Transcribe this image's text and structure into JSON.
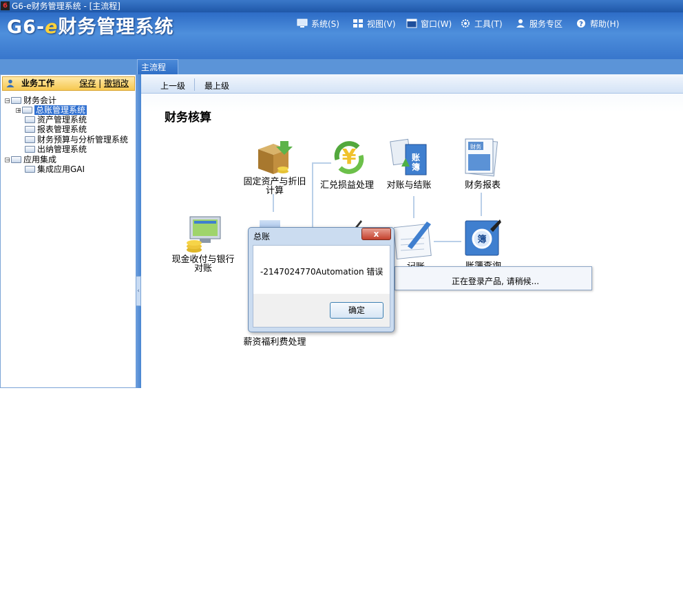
{
  "window": {
    "title": "G6-e财务管理系统 - [主流程]"
  },
  "header": {
    "logo_prefix": "G6-",
    "logo_e": "e",
    "logo_suffix": "财务管理系统",
    "menu": [
      {
        "label": "系统(S)",
        "icon": "monitor-icon"
      },
      {
        "label": "视图(V)",
        "icon": "grid-icon"
      },
      {
        "label": "窗口(W)",
        "icon": "window-icon"
      },
      {
        "label": "工具(T)",
        "icon": "gear-icon"
      },
      {
        "label": "服务专区",
        "icon": "person-icon"
      },
      {
        "label": "帮助(H)",
        "icon": "help-icon"
      }
    ]
  },
  "tabs": {
    "active": "主流程"
  },
  "left_panel": {
    "title": "业务工作",
    "save": "保存",
    "undo": "撤销改",
    "tree": [
      {
        "label": "财务会计",
        "level": 0,
        "expander": "−"
      },
      {
        "label": "总账管理系统",
        "level": 1,
        "expander": "+",
        "selected": true
      },
      {
        "label": "资产管理系统",
        "level": 1
      },
      {
        "label": "报表管理系统",
        "level": 1
      },
      {
        "label": "财务预算与分析管理系统",
        "level": 1
      },
      {
        "label": "出纳管理系统",
        "level": 1
      },
      {
        "label": "应用集成",
        "level": 0,
        "expander": "−"
      },
      {
        "label": "集成应用GAI",
        "level": 1
      }
    ]
  },
  "nav": {
    "up": "上一级",
    "top": "最上级"
  },
  "main": {
    "title": "财务核算",
    "nodes": {
      "fixed_assets": "固定资产与折旧计算",
      "exchange": "汇兑损益处理",
      "reconcile": "对账与结账",
      "reports": "财务报表",
      "cash": "现金收付与银行对账",
      "posting": "记账",
      "ledger_query": "账簿查询",
      "payroll": "薪资福利费处理"
    }
  },
  "dialog": {
    "title": "总账",
    "close": "x",
    "message": "-2147024770Automation 错误",
    "ok": "确定"
  },
  "loading": {
    "message": "正在登录产品, 请稍候..."
  },
  "colors": {
    "accent": "#2f6fd0",
    "header": "#3876cc",
    "highlight": "#f6c850"
  }
}
